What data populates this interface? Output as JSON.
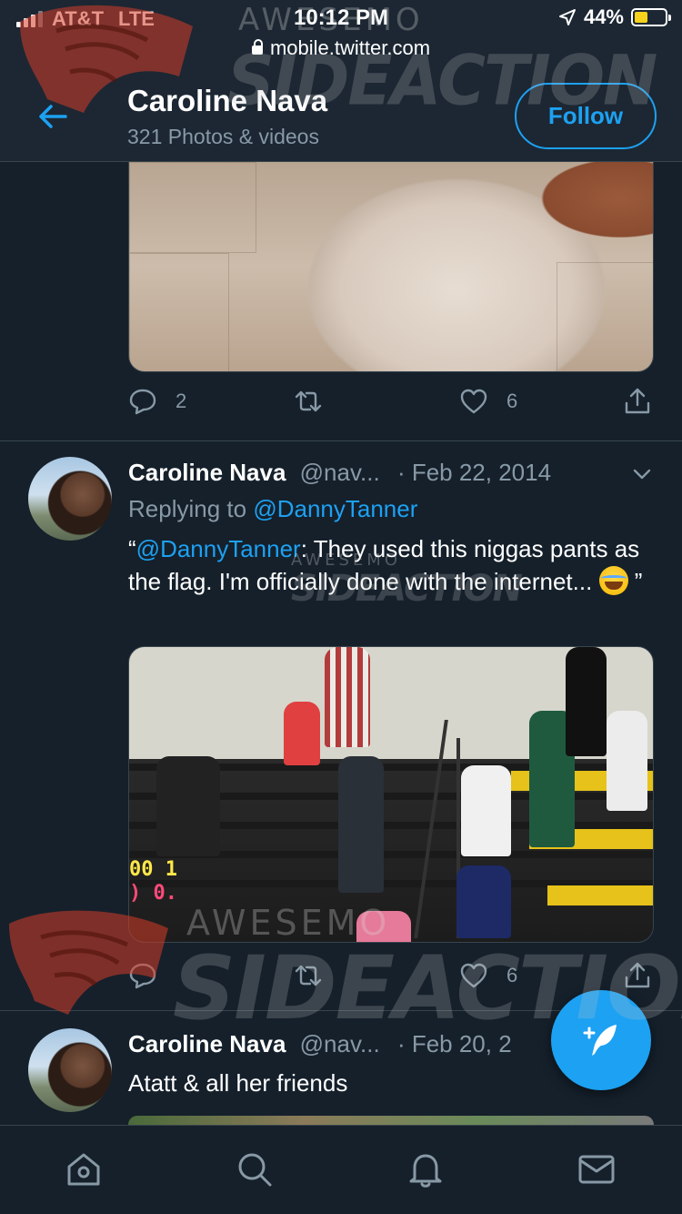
{
  "status_bar": {
    "carrier": "AT&T",
    "network": "LTE",
    "time": "10:12 PM",
    "battery": "44%",
    "battery_level": 0.44,
    "url": "mobile.twitter.com"
  },
  "header": {
    "name": "Caroline Nava",
    "subtitle": "321 Photos & videos",
    "follow_label": "Follow"
  },
  "tweets": [
    {
      "replies": "2",
      "likes": "6"
    },
    {
      "name": "Caroline Nava",
      "handle": "@nav...",
      "date": "· Feb 22, 2014",
      "replying_prefix": "Replying to",
      "replying_to": "@DannyTanner",
      "text_open_quote": "“",
      "text_mention": "@DannyTanner",
      "text_body": ": They used this niggas pants as the flag. I'm officially done with the internet... ",
      "text_close_quote": " ”",
      "score_top": "00  1",
      "score_bottom": ")    0.",
      "likes": "6"
    },
    {
      "name": "Caroline Nava",
      "handle": "@nav...",
      "date": "· Feb 20, 2",
      "text": "Atatt & all her friends"
    }
  ],
  "tabbar": {
    "items": [
      "home-icon",
      "search-icon",
      "notifications-icon",
      "messages-icon"
    ]
  },
  "watermark": {
    "brand_small_top": "AWESEMO",
    "brand_large_top": "SIDEACTION",
    "brand_small_mid": "AWESEMO",
    "brand_large_mid": "SIDEACTION",
    "brand_small_bottom": "AWESEMO",
    "brand_large_bottom": "SIDEACTION"
  },
  "colors": {
    "background": "#15202b",
    "accent": "#1da1f2",
    "muted": "#8899a6",
    "divider": "#38444d"
  }
}
